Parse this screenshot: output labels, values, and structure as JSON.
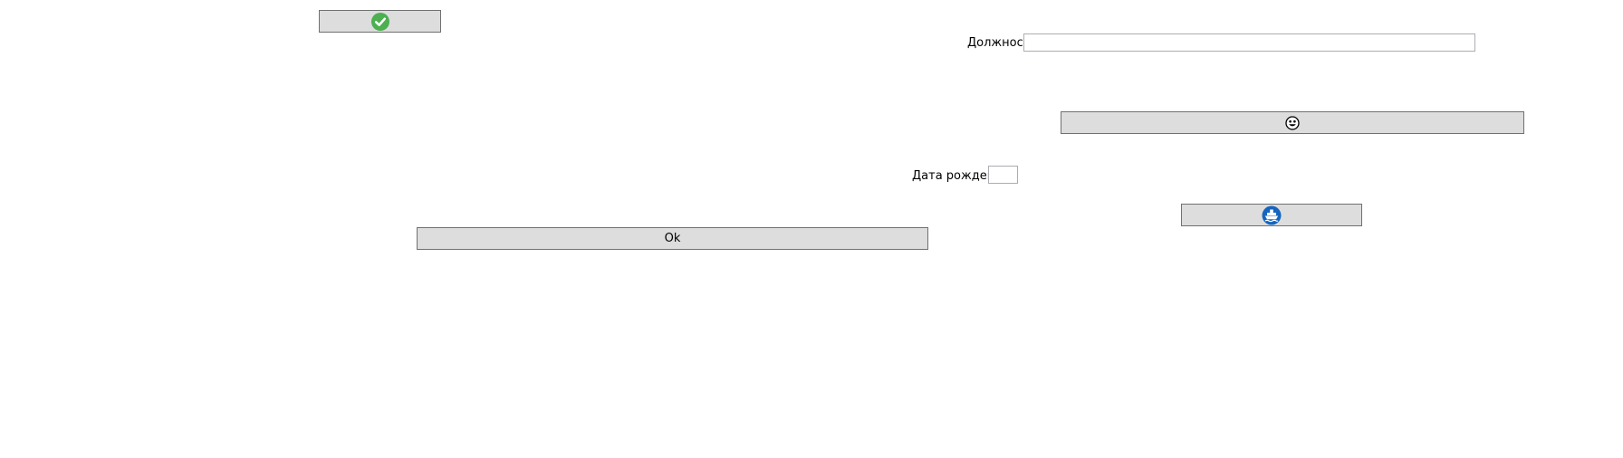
{
  "buttons": {
    "check": {
      "icon": "check-circle-icon",
      "color": "#4caf50"
    },
    "face": {
      "icon": "smiley-face-icon"
    },
    "ship": {
      "icon": "ship-icon",
      "color": "#1565c0"
    },
    "ok": {
      "label": "Ok"
    }
  },
  "fields": {
    "position": {
      "label": "Должность",
      "value": ""
    },
    "birth_date": {
      "label": "Дата рождения",
      "value": ""
    }
  }
}
